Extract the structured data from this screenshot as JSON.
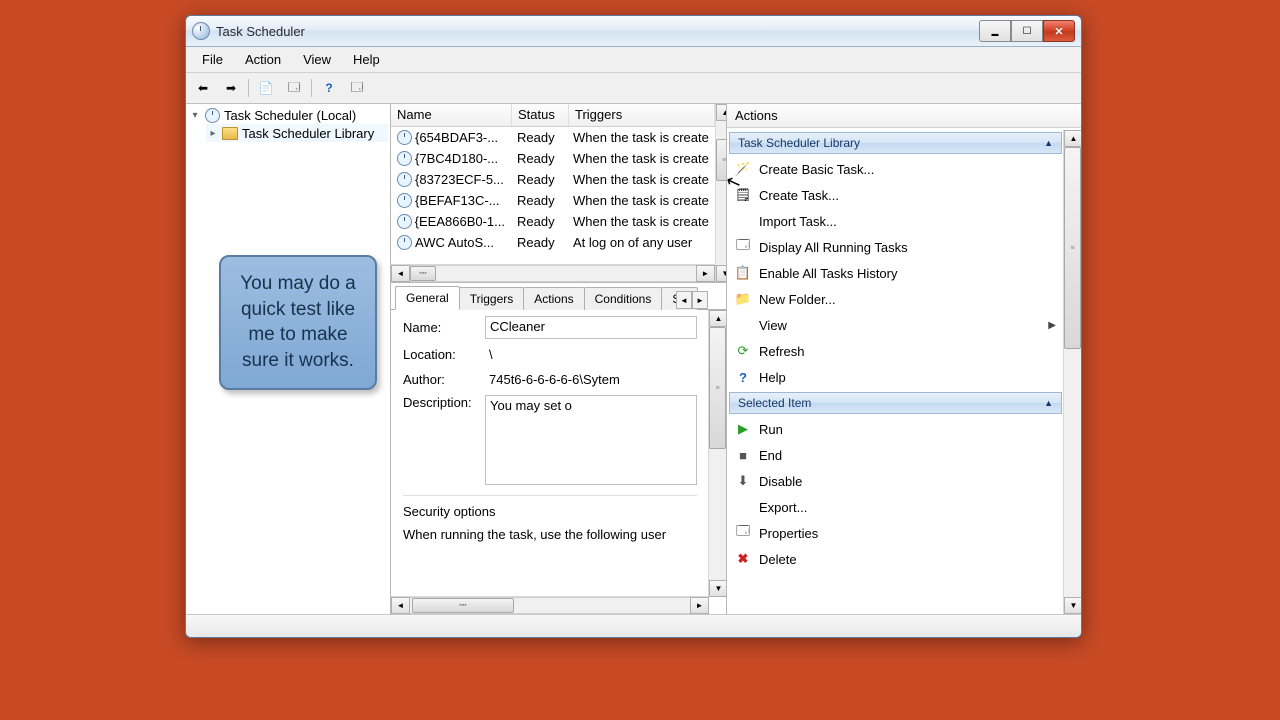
{
  "window": {
    "title": "Task Scheduler"
  },
  "menu": {
    "file": "File",
    "action": "Action",
    "view": "View",
    "help": "Help"
  },
  "tree": {
    "root": "Task Scheduler (Local)",
    "library": "Task Scheduler Library"
  },
  "columns": {
    "name": "Name",
    "status": "Status",
    "triggers": "Triggers"
  },
  "tasks": [
    {
      "name": "{654BDAF3-...",
      "status": "Ready",
      "trigger": "When the task is create"
    },
    {
      "name": "{7BC4D180-...",
      "status": "Ready",
      "trigger": "When the task is create"
    },
    {
      "name": "{83723ECF-5...",
      "status": "Ready",
      "trigger": "When the task is create"
    },
    {
      "name": "{BEFAF13C-...",
      "status": "Ready",
      "trigger": "When the task is create"
    },
    {
      "name": "{EEA866B0-1...",
      "status": "Ready",
      "trigger": "When the task is create"
    },
    {
      "name": "AWC AutoS...",
      "status": "Ready",
      "trigger": "At log on of any user"
    }
  ],
  "tabs": {
    "general": "General",
    "triggers": "Triggers",
    "actions": "Actions",
    "conditions": "Conditions",
    "settings": "Se"
  },
  "details": {
    "name_label": "Name:",
    "name_value": "CCleaner",
    "location_label": "Location:",
    "location_value": "\\",
    "author_label": "Author:",
    "author_value": "745t6-6-6-6-6-6\\Sytem",
    "desc_label": "Description:",
    "desc_value": "You may set o",
    "security_label": "Security options",
    "security_text": "When running the task, use the following user"
  },
  "actions": {
    "header": "Actions",
    "library_header": "Task Scheduler Library",
    "create_basic": "Create Basic Task...",
    "create_task": "Create Task...",
    "import_task": "Import Task...",
    "display_running": "Display All Running Tasks",
    "enable_history": "Enable All Tasks History",
    "new_folder": "New Folder...",
    "view": "View",
    "refresh": "Refresh",
    "help": "Help",
    "selected_header": "Selected Item",
    "run": "Run",
    "end": "End",
    "disable": "Disable",
    "export": "Export...",
    "properties": "Properties",
    "delete": "Delete"
  },
  "callout": "You may do a quick test like me to make sure it works."
}
